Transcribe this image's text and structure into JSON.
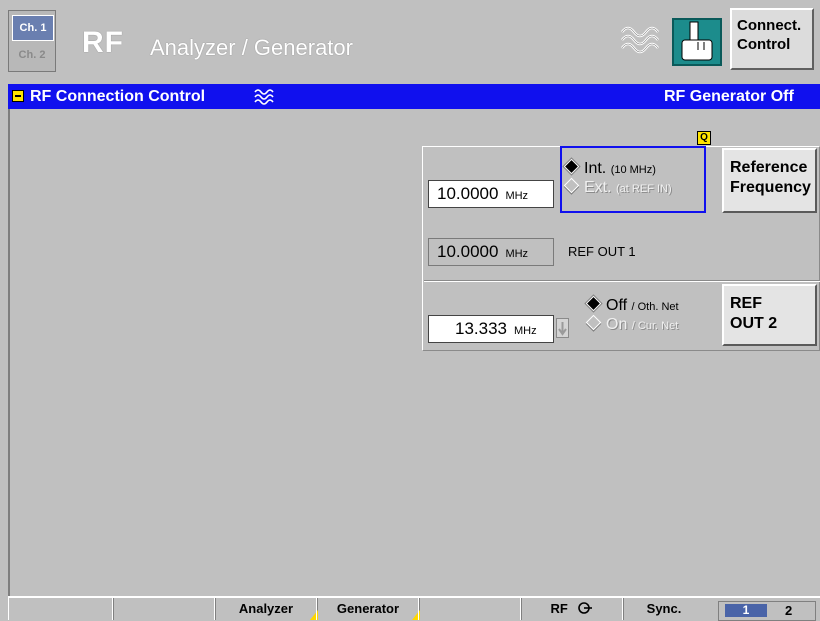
{
  "header": {
    "channel_1": "Ch. 1",
    "channel_2": "Ch. 2",
    "title_main": "RF",
    "title_sub": "Analyzer / Generator",
    "connect_button": [
      "Connect.",
      "Control"
    ]
  },
  "menubar": {
    "title": "RF Connection Control",
    "status": "RF Generator Off",
    "color": "#1010ee"
  },
  "reference": {
    "frequency_value": "10.0000",
    "frequency_unit": "MHz",
    "options": [
      {
        "label": "Int.",
        "detail": "(10 MHz)",
        "selected": true
      },
      {
        "label": "Ext.",
        "detail": "(at REF IN)",
        "selected": false
      }
    ],
    "button_label": [
      "Reference",
      "Frequency"
    ]
  },
  "ref_out_1": {
    "value": "10.0000",
    "unit": "MHz",
    "label": "REF OUT 1"
  },
  "ref_out_2": {
    "value": "13.333",
    "unit": "MHz",
    "options": [
      {
        "label": "Off",
        "detail": "/ Oth. Net",
        "selected": true
      },
      {
        "label": "On",
        "detail": "/ Cur. Net",
        "selected": false
      }
    ],
    "button_label": [
      "REF",
      "OUT 2"
    ]
  },
  "indicator": {
    "q_label": "Q"
  },
  "bottombar": {
    "keys": [
      "",
      "",
      "Analyzer",
      "Generator",
      "",
      "RF"
    ],
    "sync_label": "Sync.",
    "page_1": "1",
    "page_2": "2"
  }
}
